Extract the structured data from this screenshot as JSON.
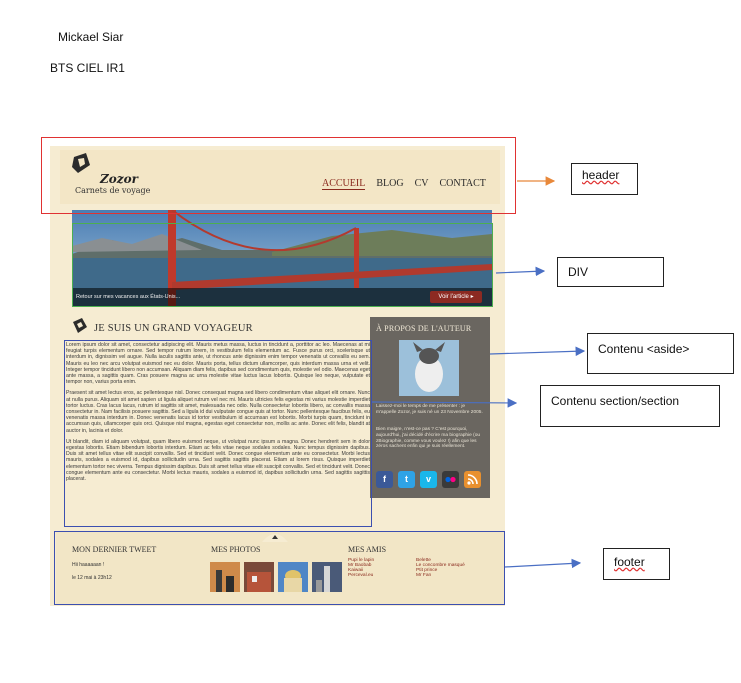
{
  "doc": {
    "author": "Mickael Siar",
    "class": "BTS CIEL IR1"
  },
  "mockup": {
    "logo": {
      "name": "Zozor",
      "subtitle": "Carnets de voyage"
    },
    "nav": [
      "ACCUEIL",
      "BLOG",
      "CV",
      "CONTACT"
    ],
    "banner": {
      "caption": "Retour sur mes vacances aux États-Unis...",
      "button": "Voir l'article ▸"
    },
    "section": {
      "title": "JE SUIS UN GRAND VOYAGEUR",
      "paragraphs": [
        "Lorem ipsum dolor sit amet, consectetur adipiscing elit. Mauris metus massa, luctus in tincidunt a, porttitor ac leo. Maecenas at mi feugiat turpis elementum ornare. Sed tempor rutrum lorem, in vestibulum felis elementum ac. Fusce purus orci, scelerisque ut interdum in, dignissim vel augue. Nulla iaculis sagittis ante, ut rhoncus ante dignissim enim tempor venenatis ut convallis eu sem. Mauris eu leo nec arcu volutpat euismod nec eu dolor. Mauris porta, tellus dictum ullamcorper, quis interdum massa urna et velit. Integer tempor tincidunt libero non accumsan. Aliquam diam felis, dapibus sed condimentum quis, molestie vel odio. Maecenas eget ante massa, a sagittis quam. Cras posuere magna ac urna molestie vitae luctus lacus lobortis. Quisque leo neque, vulputate et tempor non, varius porta enim.",
        "Praesent sit amet lectus eros, ac pellentesque nisl. Donec consequat magna sed libero condimentum vitae aliquet elit ornare. Nunc at nulla purus. Aliquam sit amet sapien ut ligula aliquet rutrum vel nec mi. Mauris ultricies felis egestas mi varius molestie imperdiet tortor luctus. Cras lacus lacus, rutrum id sagittis sit amet, malesuada nec odio. Nulla consectetur lobortis libero, ac convallis massa consectetur in. Nam facilisis posuere sagittis. Sed a ligula id dui vulputate congue quis at tortor. Nunc pellentesque faucibus felis, eu venenatis massa interdum in. Donec venenatis lacus id tortor vestibulum id accumsan est lobortis. Morbi turpis quam, tincidunt in accumsan quis, ullamcorper quis orci. Quisque nisl magna, egestas eget consectetur non, mollis ac ante. Donec elit felis, blandit at auctor in, lacinia et dolor.",
        "Ut blandit, diam id aliquam volutpat, quam libero euismod neque, ut volutpat nunc ipsum a magna. Donec hendrerit sem in dolor egestas lobortis. Etiam bibendum lobortis interdum. Etiam ac felis vitae neque sodales sodales. Nunc tempus dignissim dapibus. Duis sit amet tellus vitae elit suscipit convallis. Sed et tincidunt velit. Donec congue elementum ante eu consectetur. Morbi lectus mauris, sodales a euismod id, dapibus sollicitudin urna. Sed sagittis sagittis placerat. Etiam at lorem risus. Quisque imperdiet elementum tortor nec viverra. Tempus dignissim dapibus. Duis sit amet tellus vitae elit suscipit convallis. Sed et tincidunt velit. Donec congue elementum ante eu consectetur. Morbi lectus mauris, sodales a euismod id, dapibus sollicitudin urna. Sed sagittis sagittis placerat."
      ]
    },
    "aside": {
      "title": "À PROPOS DE L'AUTEUR",
      "text1": "Laissez-moi le temps de me présenter : je m'appelle Zozor, je suis né un 23 Novembre 2005.",
      "text2": "Bien maigre, n'est-ce pas ? C'est pourquoi, aujourd'hui, j'ai décidé d'écrire ma biographie (ou zBiographie, comme vous voulez !) afin que les zéros sachent enfin qui je suis réellement."
    },
    "footer": {
      "tweet_title": "MON DERNIER TWEET",
      "tweet_text": "Hii haaaaaan !",
      "tweet_date": "le 12 mai à 23h12",
      "photos_title": "MES PHOTOS",
      "friends_title": "MES AMIS",
      "friends_col1": [
        "Pupi le lapin",
        "Mr Baobab",
        "Kaiwaii",
        "Perceval.eu"
      ],
      "friends_col2": [
        "Belette",
        "Le concombre masqué",
        "Ptit prince",
        "Mr Fan"
      ]
    }
  },
  "annotations": {
    "header": "header",
    "div": "DIV",
    "aside": "Contenu <aside>",
    "section": "Contenu section/section",
    "footer": "footer"
  },
  "colors": {
    "header_box": "#e03232",
    "arrow_orange": "#e8883a",
    "arrow_blue": "#4a6fc4",
    "div_box": "#4caf50",
    "section_box": "#3c4fb0"
  }
}
